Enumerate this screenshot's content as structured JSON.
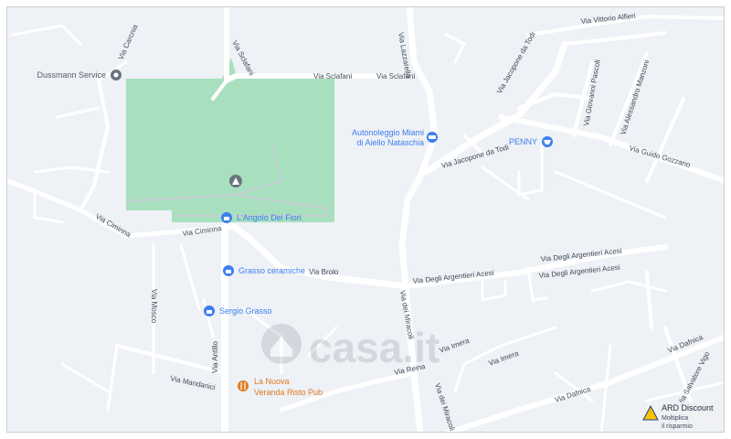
{
  "map": {
    "streets": {
      "sclafani_top": "Via Sclafani",
      "sclafani_vertical": "Via Sclafani",
      "sclafani_right": "Via Sclafani",
      "carcnia": "Via Carcnia",
      "ciminna_left": "Via Ciminna",
      "ciminna_right": "Via Ciminna",
      "brolo": "Via Brolo",
      "lazzarello": "Via Lazzarello",
      "jacopone_top": "Via Jacopone da Todi",
      "jacopone_lower": "Via Jacopone da Todi",
      "vittorio_alfieri": "Via Vittorio Alfieri",
      "giovanni_pascoli": "Via Giovanni Pascoli",
      "alessandro_manzoni": "Via Alessandro Manzoni",
      "guido_gozzano": "Via Guido Gozzano",
      "argentieri_1": "Via Degli Argentieri Acesi",
      "argentieri_2": "Via Degli Argentieri Acesi",
      "argentieri_3": "Via Degli Argentieri Acesi",
      "miracoli_1": "Via dei Miracoli",
      "miracoli_2": "Via dei Miracoli",
      "mosco": "Via Mosco",
      "antillo": "Via Antillo",
      "mandanici": "Via Mandanici",
      "reina": "Via Reina",
      "imera": "Via Imera",
      "dafnica_1": "Via Dafnica",
      "dafnica_2": "Via Dafnica",
      "salvatore_vigo": "Via Salvatore Vigo",
      "partial_imera": "Via Imera"
    },
    "pois": {
      "dussmann": "Dussmann Service",
      "autonoleggio_1": "Autonoleggio Miami",
      "autonoleggio_2": "di Aiello Nataschia",
      "penny": "PENNY",
      "angolo": "L'Angolo Dei Fiori",
      "grasso_ceramiche": "Grasso ceramiche",
      "sergio_grasso": "Sergio Grasso",
      "nuova_veranda_1": "La Nuova",
      "nuova_veranda_2": "Veranda Risto Pub"
    },
    "ad": {
      "title": "ARD Discount",
      "line1": "Moltiplica",
      "line2": "il risparmio"
    },
    "watermark": "casa.it",
    "colors": {
      "park": "#a8e0bf",
      "road": "#ffffff",
      "background": "#eef1f5",
      "poi_blue": "#3d7ff0",
      "poi_orange": "#e07b23",
      "poi_gray": "#6b7480"
    },
    "icons": [
      "map-pin-icon",
      "lock-shop-icon",
      "cart-icon",
      "car-icon",
      "restaurant-icon",
      "monument-icon"
    ]
  }
}
